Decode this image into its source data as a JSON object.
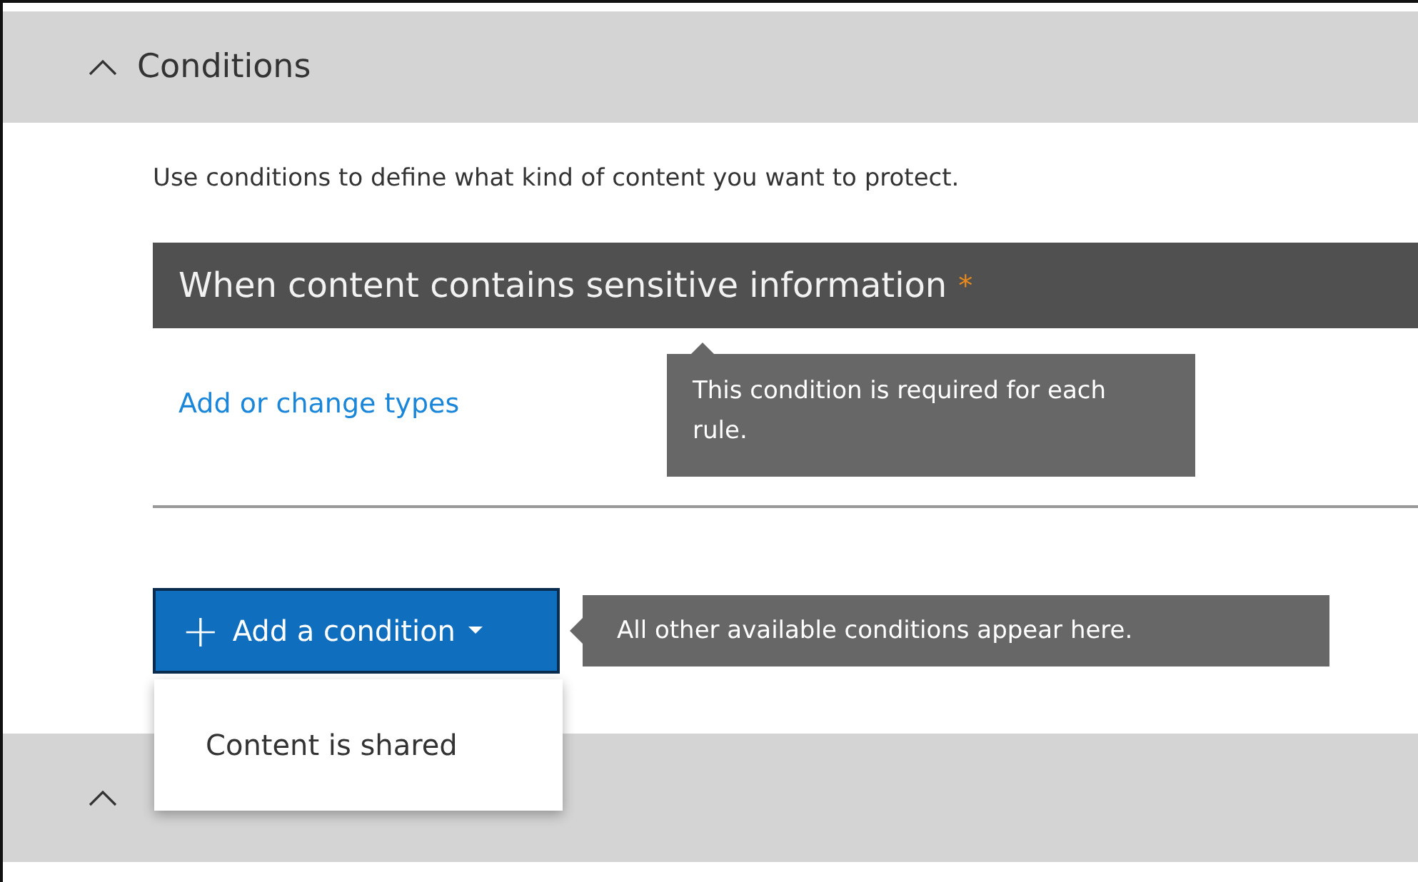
{
  "section": {
    "title": "Conditions",
    "expanded": true
  },
  "description": "Use conditions to define what kind of content you want to protect.",
  "condition": {
    "title": "When content contains sensitive information",
    "required_mark": "*"
  },
  "required_tooltip": "This condition is required for each rule.",
  "link": "Add or change types",
  "add_button": {
    "label": "Add a condition",
    "icon": "+"
  },
  "add_tooltip": "All other available conditions appear here.",
  "dropdown": {
    "items": [
      {
        "label": "Content is shared"
      }
    ]
  },
  "next_section": {
    "expanded": true
  }
}
